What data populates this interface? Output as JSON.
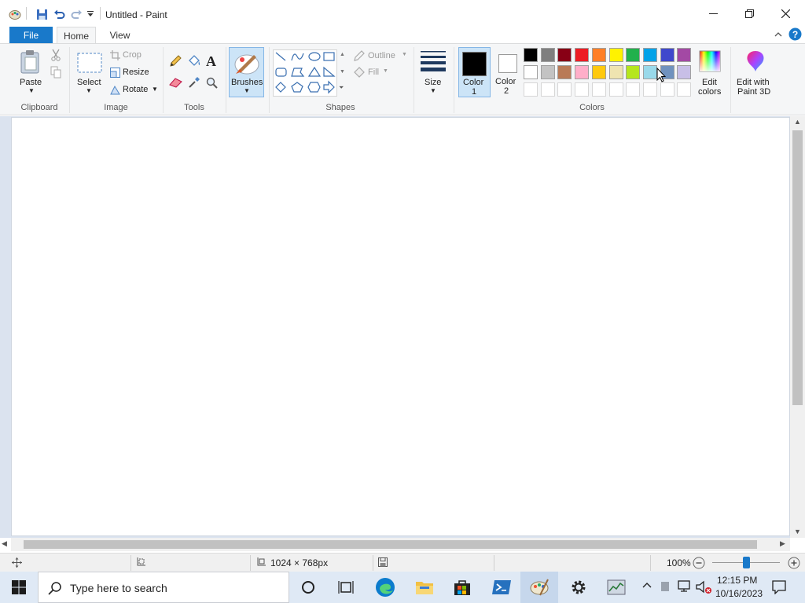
{
  "window": {
    "title": "Untitled - Paint"
  },
  "tabs": {
    "file": "File",
    "home": "Home",
    "view": "View"
  },
  "clipboard": {
    "paste": "Paste",
    "label": "Clipboard"
  },
  "image": {
    "select": "Select",
    "crop": "Crop",
    "resize": "Resize",
    "rotate": "Rotate",
    "label": "Image"
  },
  "tools": {
    "label": "Tools"
  },
  "brushes": {
    "label": "Brushes"
  },
  "shapes": {
    "outline": "Outline",
    "fill": "Fill",
    "label": "Shapes"
  },
  "size": {
    "label": "Size"
  },
  "color1": {
    "label_a": "Color",
    "label_b": "1",
    "value": "#000000"
  },
  "color2": {
    "label_a": "Color",
    "label_b": "2",
    "value": "#ffffff"
  },
  "colors": {
    "label": "Colors",
    "row1": [
      "#000000",
      "#7f7f7f",
      "#880015",
      "#ed1c24",
      "#ff7f27",
      "#fff200",
      "#22b14c",
      "#00a2e8",
      "#3f48cc",
      "#a349a4"
    ],
    "row2": [
      "#ffffff",
      "#c3c3c3",
      "#b97a57",
      "#ffaec9",
      "#ffc90e",
      "#efe4b0",
      "#b5e61d",
      "#99d9ea",
      "#7092be",
      "#c8bfe7"
    ],
    "row3": [
      "#ffffff",
      "#ffffff",
      "#ffffff",
      "#ffffff",
      "#ffffff",
      "#ffffff",
      "#ffffff",
      "#ffffff",
      "#ffffff",
      "#ffffff"
    ]
  },
  "edit_colors": {
    "a": "Edit",
    "b": "colors"
  },
  "paint3d": {
    "a": "Edit with",
    "b": "Paint 3D"
  },
  "status": {
    "dimensions": "1024 × 768px",
    "zoom": "100%",
    "zoom_level": 0.5
  },
  "taskbar": {
    "search_placeholder": "Type here to search",
    "time": "12:15 PM",
    "date": "10/16/2023"
  }
}
